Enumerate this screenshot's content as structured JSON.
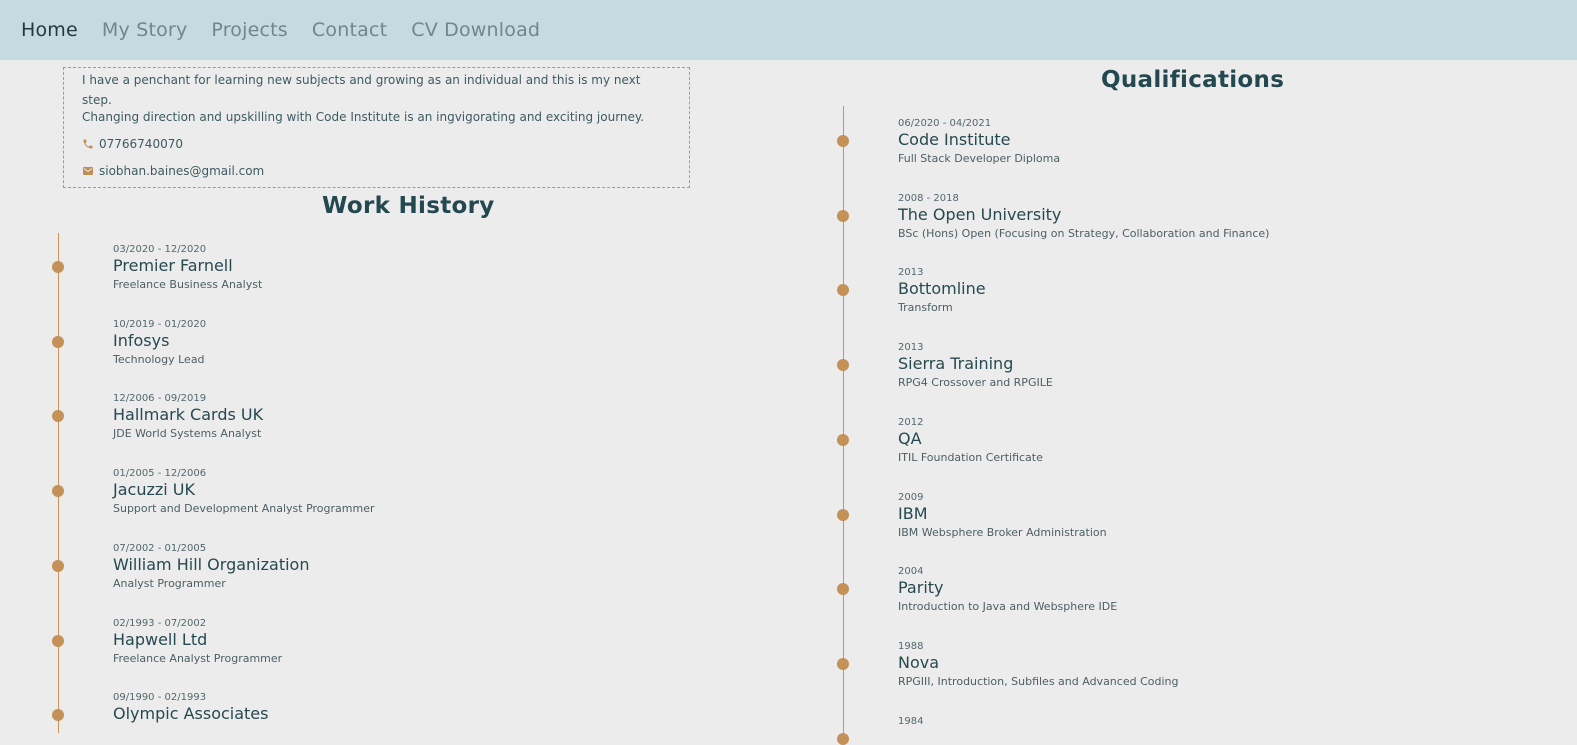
{
  "nav": {
    "items": [
      {
        "label": "Home",
        "active": true
      },
      {
        "label": "My Story",
        "active": false
      },
      {
        "label": "Projects",
        "active": false
      },
      {
        "label": "Contact",
        "active": false
      },
      {
        "label": "CV Download",
        "active": false
      }
    ]
  },
  "intro": {
    "line1": "I have a penchant for learning new subjects and growing as an individual and this is my next step.",
    "line2": "Changing direction and upskilling with Code Institute is an ingvigorating and exciting  journey.",
    "phone": "07766740070",
    "phone_icon": "phone-icon",
    "email": "siobhan.baines@gmail.com",
    "email_icon": "envelope-icon"
  },
  "work_history": {
    "title": "Work History",
    "entries": [
      {
        "date": "03/2020 - 12/2020",
        "company": "Premier Farnell",
        "role": "Freelance Business Analyst"
      },
      {
        "date": "10/2019 - 01/2020",
        "company": "Infosys",
        "role": "Technology Lead"
      },
      {
        "date": "12/2006 - 09/2019",
        "company": "Hallmark Cards UK",
        "role": "JDE World Systems Analyst"
      },
      {
        "date": "01/2005 - 12/2006",
        "company": "Jacuzzi UK",
        "role": "Support and Development Analyst Programmer"
      },
      {
        "date": "07/2002 - 01/2005",
        "company": "William Hill Organization",
        "role": "Analyst Programmer"
      },
      {
        "date": "02/1993 - 07/2002",
        "company": "Hapwell Ltd",
        "role": "Freelance Analyst Programmer"
      },
      {
        "date": "09/1990 - 02/1993",
        "company": "Olympic Associates",
        "role": ""
      }
    ]
  },
  "qualifications": {
    "title": "Qualifications",
    "entries": [
      {
        "date": "06/2020 - 04/2021",
        "institution": "Code Institute",
        "course": "Full Stack Developer Diploma"
      },
      {
        "date": "2008 - 2018",
        "institution": "The Open University",
        "course": "BSc (Hons) Open (Focusing on Strategy, Collaboration and Finance)"
      },
      {
        "date": "2013",
        "institution": "Bottomline",
        "course": "Transform"
      },
      {
        "date": "2013",
        "institution": "Sierra Training",
        "course": "RPG4 Crossover and RPGILE"
      },
      {
        "date": "2012",
        "institution": "QA",
        "course": "ITIL Foundation Certificate"
      },
      {
        "date": "2009",
        "institution": "IBM",
        "course": "IBM Websphere Broker Administration"
      },
      {
        "date": "2004",
        "institution": "Parity",
        "course": "Introduction to Java and Websphere IDE"
      },
      {
        "date": "1988",
        "institution": "Nova",
        "course": "RPGIII, Introduction, Subfiles and Advanced Coding"
      },
      {
        "date": "1984",
        "institution": "",
        "course": ""
      }
    ]
  },
  "colors": {
    "navbar": "#c5dbe0",
    "background": "#ececec",
    "accent": "#c49158",
    "heading": "#234850"
  }
}
